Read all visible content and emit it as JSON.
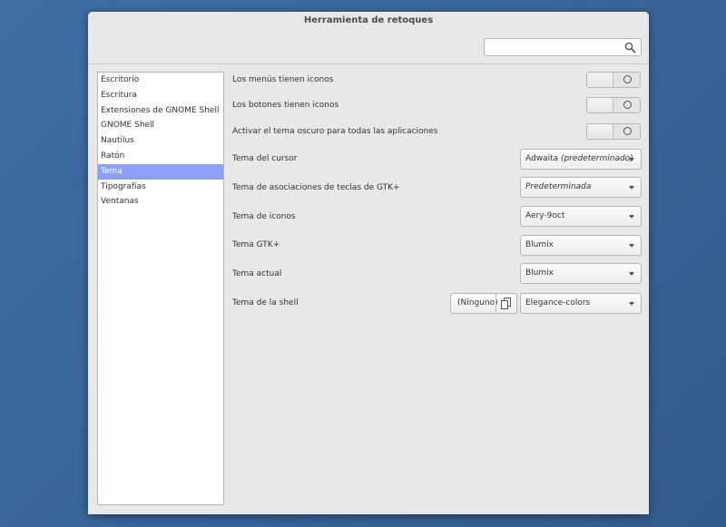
{
  "window": {
    "title": "Herramienta de retoques"
  },
  "search": {
    "value": "",
    "placeholder": "",
    "icon": "search-icon"
  },
  "sidebar": {
    "items": [
      {
        "label": "Escritorio"
      },
      {
        "label": "Escritura"
      },
      {
        "label": "Extensiones de GNOME Shell"
      },
      {
        "label": "GNOME Shell"
      },
      {
        "label": "Nautilus"
      },
      {
        "label": "Ratón"
      },
      {
        "label": "Tema"
      },
      {
        "label": "Tipografías"
      },
      {
        "label": "Ventanas"
      }
    ],
    "selected": "Tema"
  },
  "settings": {
    "menus_icons": {
      "label": "Los menús tienen iconos",
      "state": "off"
    },
    "buttons_icons": {
      "label": "Los botones tienen iconos",
      "state": "off"
    },
    "dark_theme": {
      "label": "Activar el tema oscuro para todas las aplicaciones",
      "state": "off"
    },
    "cursor_theme": {
      "label": "Tema del cursor",
      "value_main": "Adwaita ",
      "value_italic": "(predeterminado)"
    },
    "keys_theme": {
      "label": "Tema de asociaciones de teclas de GTK+",
      "value_main": "",
      "value_italic": "Predeterminada"
    },
    "icon_theme": {
      "label": "Tema de iconos",
      "value": "Aery-9oct"
    },
    "gtk_theme": {
      "label": "Tema GTK+",
      "value": "Blumix"
    },
    "current_theme": {
      "label": "Tema actual",
      "value": "Blumix"
    },
    "shell_theme": {
      "label": "Tema de la shell",
      "none_label": "(Ninguno)",
      "value": "Elegance-colors"
    }
  },
  "colors": {
    "selection": "#8fa1f6",
    "window_bg": "#e8e8e7",
    "desktop_bg": "#3a679c"
  }
}
